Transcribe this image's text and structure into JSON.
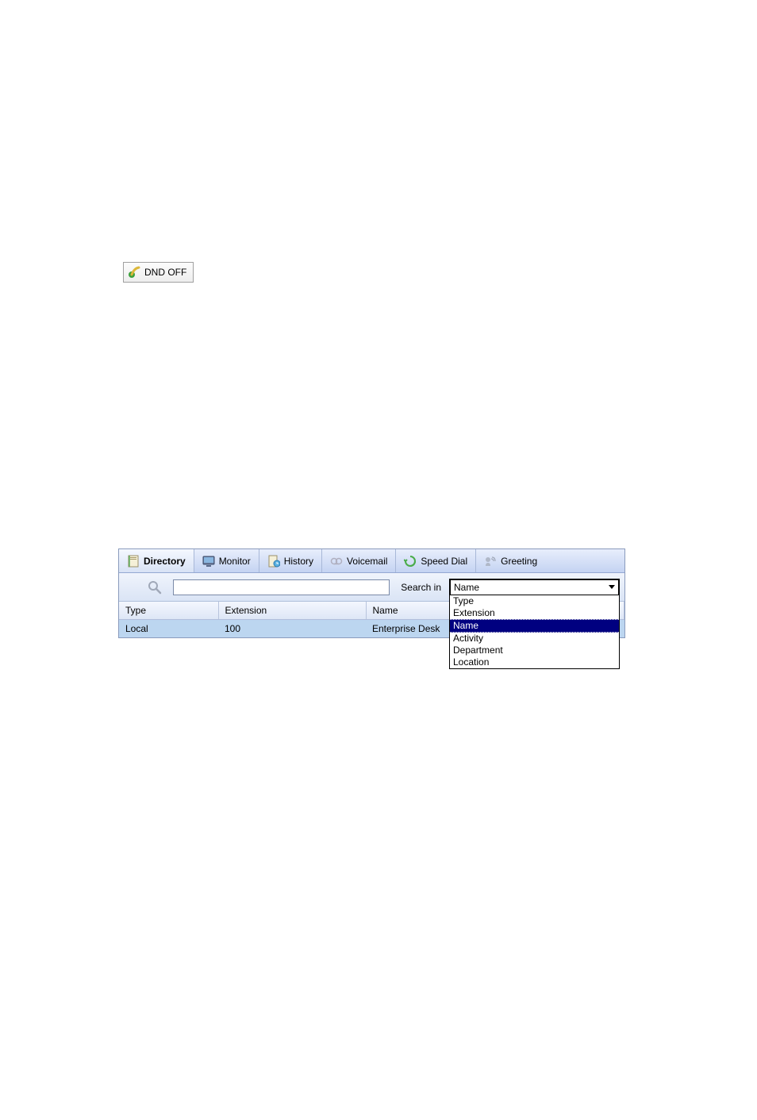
{
  "dnd": {
    "label": "DND OFF"
  },
  "tabs": [
    {
      "label": "Directory",
      "icon": "directory"
    },
    {
      "label": "Monitor",
      "icon": "monitor"
    },
    {
      "label": "History",
      "icon": "history"
    },
    {
      "label": "Voicemail",
      "icon": "voicemail"
    },
    {
      "label": "Speed Dial",
      "icon": "speeddial"
    },
    {
      "label": "Greeting",
      "icon": "greeting"
    }
  ],
  "search": {
    "value": "",
    "label": "Search in",
    "selected": "Name",
    "options": [
      "Type",
      "Extension",
      "Name",
      "Activity",
      "Department",
      "Location"
    ]
  },
  "table": {
    "columns": [
      "Type",
      "Extension",
      "Name"
    ],
    "rows": [
      {
        "type": "Local",
        "extension": "100",
        "name": "Enterprise Desk"
      }
    ]
  }
}
